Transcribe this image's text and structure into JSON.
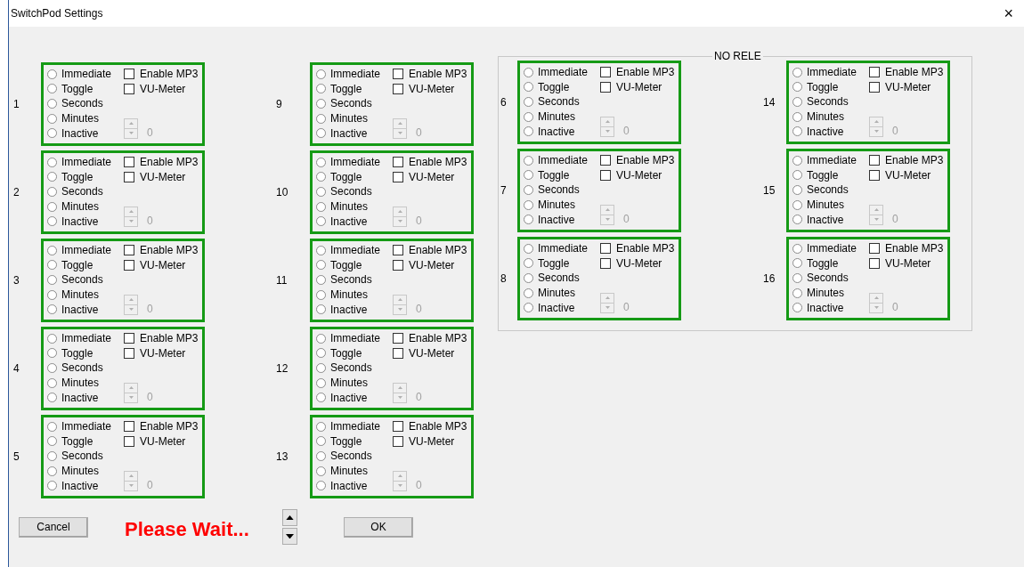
{
  "window": {
    "title": "SwitchPod Settings",
    "close": "×"
  },
  "columns": [
    {
      "panels": [
        {
          "number": "1",
          "options": [
            {
              "label": "Immediate",
              "selected": false
            },
            {
              "label": "Toggle",
              "selected": false
            },
            {
              "label": "Seconds",
              "selected": false
            },
            {
              "label": "Minutes",
              "selected": false
            },
            {
              "label": "Inactive",
              "selected": false
            }
          ],
          "checks": [
            {
              "label": "Enable MP3",
              "checked": false
            },
            {
              "label": "VU-Meter",
              "checked": false
            }
          ],
          "counter": {
            "value": "0",
            "disabled": true
          }
        },
        {
          "number": "2",
          "options": [
            {
              "label": "Immediate",
              "selected": false
            },
            {
              "label": "Toggle",
              "selected": false
            },
            {
              "label": "Seconds",
              "selected": false
            },
            {
              "label": "Minutes",
              "selected": false
            },
            {
              "label": "Inactive",
              "selected": false
            }
          ],
          "checks": [
            {
              "label": "Enable MP3",
              "checked": false
            },
            {
              "label": "VU-Meter",
              "checked": false
            }
          ],
          "counter": {
            "value": "0",
            "disabled": true
          }
        },
        {
          "number": "3",
          "options": [
            {
              "label": "Immediate",
              "selected": false
            },
            {
              "label": "Toggle",
              "selected": false
            },
            {
              "label": "Seconds",
              "selected": false
            },
            {
              "label": "Minutes",
              "selected": false
            },
            {
              "label": "Inactive",
              "selected": false
            }
          ],
          "checks": [
            {
              "label": "Enable MP3",
              "checked": false
            },
            {
              "label": "VU-Meter",
              "checked": false
            }
          ],
          "counter": {
            "value": "0",
            "disabled": true
          }
        },
        {
          "number": "4",
          "options": [
            {
              "label": "Immediate",
              "selected": false
            },
            {
              "label": "Toggle",
              "selected": false
            },
            {
              "label": "Seconds",
              "selected": false
            },
            {
              "label": "Minutes",
              "selected": false
            },
            {
              "label": "Inactive",
              "selected": false
            }
          ],
          "checks": [
            {
              "label": "Enable MP3",
              "checked": false
            },
            {
              "label": "VU-Meter",
              "checked": false
            }
          ],
          "counter": {
            "value": "0",
            "disabled": true
          }
        },
        {
          "number": "5",
          "options": [
            {
              "label": "Immediate",
              "selected": false
            },
            {
              "label": "Toggle",
              "selected": false
            },
            {
              "label": "Seconds",
              "selected": false
            },
            {
              "label": "Minutes",
              "selected": false
            },
            {
              "label": "Inactive",
              "selected": false
            }
          ],
          "checks": [
            {
              "label": "Enable MP3",
              "checked": false
            },
            {
              "label": "VU-Meter",
              "checked": false
            }
          ],
          "counter": {
            "value": "0",
            "disabled": true
          }
        }
      ]
    },
    {
      "panels": [
        {
          "number": "9",
          "options": [
            {
              "label": "Immediate",
              "selected": false
            },
            {
              "label": "Toggle",
              "selected": false
            },
            {
              "label": "Seconds",
              "selected": false
            },
            {
              "label": "Minutes",
              "selected": false
            },
            {
              "label": "Inactive",
              "selected": false
            }
          ],
          "checks": [
            {
              "label": "Enable MP3",
              "checked": false
            },
            {
              "label": "VU-Meter",
              "checked": false
            }
          ],
          "counter": {
            "value": "0",
            "disabled": true
          }
        },
        {
          "number": "10",
          "options": [
            {
              "label": "Immediate",
              "selected": false
            },
            {
              "label": "Toggle",
              "selected": false
            },
            {
              "label": "Seconds",
              "selected": false
            },
            {
              "label": "Minutes",
              "selected": false
            },
            {
              "label": "Inactive",
              "selected": false
            }
          ],
          "checks": [
            {
              "label": "Enable MP3",
              "checked": false
            },
            {
              "label": "VU-Meter",
              "checked": false
            }
          ],
          "counter": {
            "value": "0",
            "disabled": true
          }
        },
        {
          "number": "11",
          "options": [
            {
              "label": "Immediate",
              "selected": false
            },
            {
              "label": "Toggle",
              "selected": false
            },
            {
              "label": "Seconds",
              "selected": false
            },
            {
              "label": "Minutes",
              "selected": false
            },
            {
              "label": "Inactive",
              "selected": false
            }
          ],
          "checks": [
            {
              "label": "Enable MP3",
              "checked": false
            },
            {
              "label": "VU-Meter",
              "checked": false
            }
          ],
          "counter": {
            "value": "0",
            "disabled": true
          }
        },
        {
          "number": "12",
          "options": [
            {
              "label": "Immediate",
              "selected": false
            },
            {
              "label": "Toggle",
              "selected": false
            },
            {
              "label": "Seconds",
              "selected": false
            },
            {
              "label": "Minutes",
              "selected": false
            },
            {
              "label": "Inactive",
              "selected": false
            }
          ],
          "checks": [
            {
              "label": "Enable MP3",
              "checked": false
            },
            {
              "label": "VU-Meter",
              "checked": false
            }
          ],
          "counter": {
            "value": "0",
            "disabled": true
          }
        },
        {
          "number": "13",
          "options": [
            {
              "label": "Immediate",
              "selected": false
            },
            {
              "label": "Toggle",
              "selected": false
            },
            {
              "label": "Seconds",
              "selected": false
            },
            {
              "label": "Minutes",
              "selected": false
            },
            {
              "label": "Inactive",
              "selected": false
            }
          ],
          "checks": [
            {
              "label": "Enable MP3",
              "checked": false
            },
            {
              "label": "VU-Meter",
              "checked": false
            }
          ],
          "counter": {
            "value": "0",
            "disabled": true
          }
        }
      ]
    }
  ],
  "relay_group": {
    "title": "NO RELE",
    "columns": [
      {
        "panels": [
          {
            "number": "6",
            "options": [
              {
                "label": "Immediate",
                "selected": false
              },
              {
                "label": "Toggle",
                "selected": false
              },
              {
                "label": "Seconds",
                "selected": false
              },
              {
                "label": "Minutes",
                "selected": false
              },
              {
                "label": "Inactive",
                "selected": false
              }
            ],
            "checks": [
              {
                "label": "Enable MP3",
                "checked": false
              },
              {
                "label": "VU-Meter",
                "checked": false
              }
            ],
            "counter": {
              "value": "0",
              "disabled": true
            }
          },
          {
            "number": "7",
            "options": [
              {
                "label": "Immediate",
                "selected": false
              },
              {
                "label": "Toggle",
                "selected": false
              },
              {
                "label": "Seconds",
                "selected": false
              },
              {
                "label": "Minutes",
                "selected": false
              },
              {
                "label": "Inactive",
                "selected": false
              }
            ],
            "checks": [
              {
                "label": "Enable MP3",
                "checked": false
              },
              {
                "label": "VU-Meter",
                "checked": false
              }
            ],
            "counter": {
              "value": "0",
              "disabled": true
            }
          },
          {
            "number": "8",
            "options": [
              {
                "label": "Immediate",
                "selected": false
              },
              {
                "label": "Toggle",
                "selected": false
              },
              {
                "label": "Seconds",
                "selected": false
              },
              {
                "label": "Minutes",
                "selected": false
              },
              {
                "label": "Inactive",
                "selected": false
              }
            ],
            "checks": [
              {
                "label": "Enable MP3",
                "checked": false
              },
              {
                "label": "VU-Meter",
                "checked": false
              }
            ],
            "counter": {
              "value": "0",
              "disabled": true
            }
          }
        ]
      },
      {
        "panels": [
          {
            "number": "14",
            "options": [
              {
                "label": "Immediate",
                "selected": false
              },
              {
                "label": "Toggle",
                "selected": false
              },
              {
                "label": "Seconds",
                "selected": false
              },
              {
                "label": "Minutes",
                "selected": false
              },
              {
                "label": "Inactive",
                "selected": false
              }
            ],
            "checks": [
              {
                "label": "Enable MP3",
                "checked": false
              },
              {
                "label": "VU-Meter",
                "checked": false
              }
            ],
            "counter": {
              "value": "0",
              "disabled": true
            }
          },
          {
            "number": "15",
            "options": [
              {
                "label": "Immediate",
                "selected": false
              },
              {
                "label": "Toggle",
                "selected": false
              },
              {
                "label": "Seconds",
                "selected": false
              },
              {
                "label": "Minutes",
                "selected": false
              },
              {
                "label": "Inactive",
                "selected": false
              }
            ],
            "checks": [
              {
                "label": "Enable MP3",
                "checked": false
              },
              {
                "label": "VU-Meter",
                "checked": false
              }
            ],
            "counter": {
              "value": "0",
              "disabled": true
            }
          },
          {
            "number": "16",
            "options": [
              {
                "label": "Immediate",
                "selected": false
              },
              {
                "label": "Toggle",
                "selected": false
              },
              {
                "label": "Seconds",
                "selected": false
              },
              {
                "label": "Minutes",
                "selected": false
              },
              {
                "label": "Inactive",
                "selected": false
              }
            ],
            "checks": [
              {
                "label": "Enable MP3",
                "checked": false
              },
              {
                "label": "VU-Meter",
                "checked": false
              }
            ],
            "counter": {
              "value": "0",
              "disabled": true
            }
          }
        ]
      }
    ]
  },
  "footer": {
    "cancel": "Cancel",
    "status": "Please Wait...",
    "ok": "OK"
  }
}
